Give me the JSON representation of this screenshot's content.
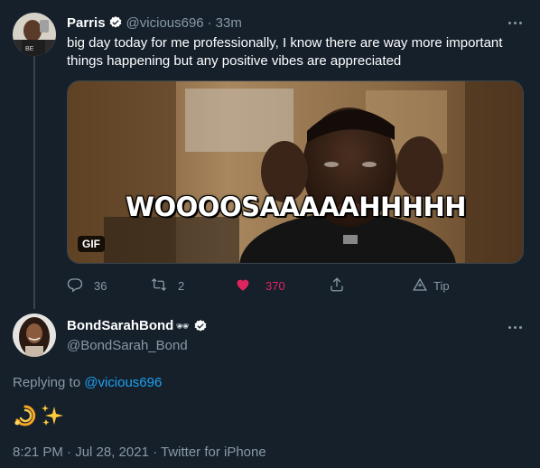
{
  "colors": {
    "background": "#15202b",
    "text_primary": "#ffffff",
    "text_muted": "#8899a6",
    "link": "#1da1f2",
    "like": "#e0245e",
    "divider": "#38444d"
  },
  "tweet": {
    "author_name": "Parris",
    "verified_icon": "verified-badge-icon",
    "handle": "@vicious696",
    "separator": "·",
    "time": "33m",
    "text": "big day today for me professionally, I know there are way more important things happening but any positive vibes are appreciated",
    "media": {
      "caption": "WOOOOSAAAAAHHHHH",
      "badge": "GIF"
    },
    "actions": {
      "replies": "36",
      "retweets": "2",
      "likes": "370",
      "tip_label": "Tip"
    }
  },
  "reply": {
    "author_name": "BondSarahBond",
    "name_emoji": "🕶",
    "verified_icon": "verified-badge-icon",
    "handle": "@BondSarah_Bond",
    "replying_prefix": "Replying to ",
    "replying_to": "@vicious696",
    "body_emoji": [
      "dizzy-emoji",
      "sparkles-emoji"
    ],
    "timestamp": "8:21 PM · Jul 28, 2021 · Twitter for iPhone"
  }
}
